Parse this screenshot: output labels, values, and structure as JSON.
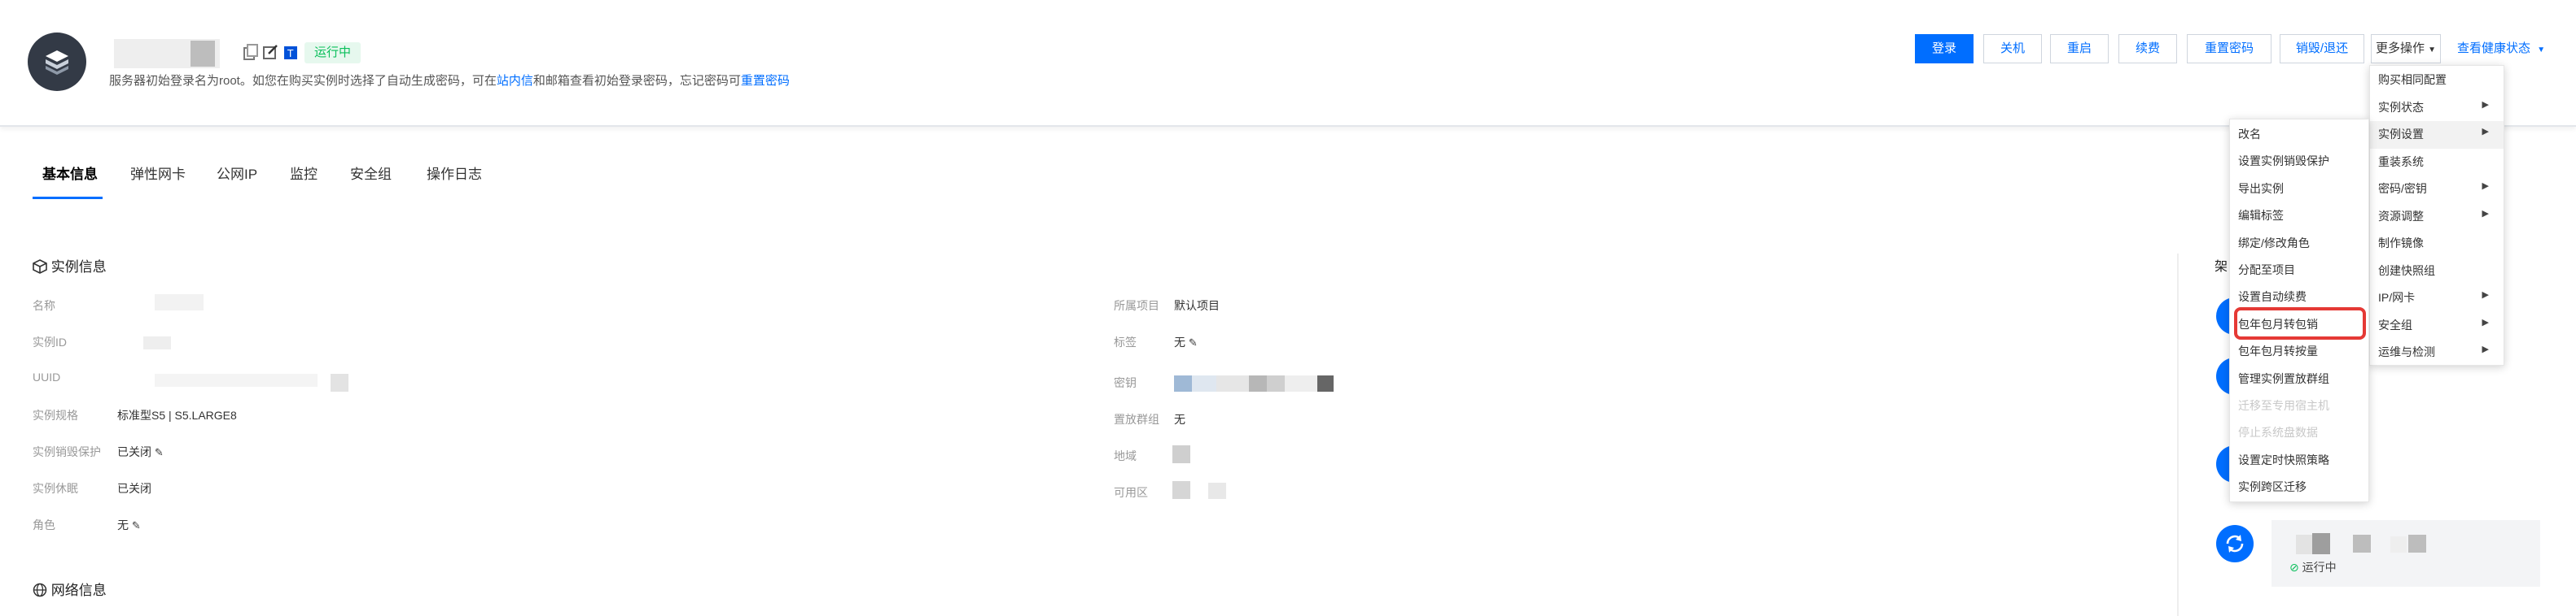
{
  "header": {
    "status": "运行中",
    "notice_prefix": "服务器初始登录名为root。如您在购买实例时选择了自动生成密码，可在",
    "notice_link1": "站内信",
    "notice_middle": "和邮箱查看初始登录密码，忘记密码可",
    "notice_link2": "重置密码",
    "icons": [
      "server-icon",
      "copy-icon",
      "edit-icon",
      "terminal-icon"
    ]
  },
  "actions": {
    "login": "登录",
    "shutdown": "关机",
    "restart": "重启",
    "renew": "续费",
    "reset_password": "重置密码",
    "terminate": "销毁/退还",
    "more": "更多操作",
    "health": "查看健康状态"
  },
  "tabs": [
    "基本信息",
    "弹性网卡",
    "公网IP",
    "监控",
    "安全组",
    "操作日志"
  ],
  "instance_info": {
    "title": "实例信息",
    "left": [
      {
        "label": "名称",
        "value": ""
      },
      {
        "label": "实例ID",
        "value": ""
      },
      {
        "label": "UUID",
        "value": ""
      },
      {
        "label": "实例规格",
        "value": "标准型S5 | S5.LARGE8"
      },
      {
        "label": "实例销毁保护",
        "value": "已关闭"
      },
      {
        "label": "实例休眠",
        "value": "已关闭"
      },
      {
        "label": "角色",
        "value": "无"
      }
    ],
    "right": [
      {
        "label": "所属项目",
        "value": "默认项目"
      },
      {
        "label": "标签",
        "value": "无"
      },
      {
        "label": "密钥",
        "value": ""
      },
      {
        "label": "置放群组",
        "value": "无"
      },
      {
        "label": "地域",
        "value": ""
      },
      {
        "label": "可用区",
        "value": ""
      }
    ]
  },
  "network_info": {
    "title": "网络信息"
  },
  "side": {
    "title_fragment": "架",
    "status": "运行中"
  },
  "more_menu": {
    "items": [
      {
        "label": "购买相同配置",
        "has_sub": false
      },
      {
        "label": "实例状态",
        "has_sub": true
      },
      {
        "label": "实例设置",
        "has_sub": true,
        "highlighted": true
      },
      {
        "label": "重装系统",
        "has_sub": false
      },
      {
        "label": "密码/密钥",
        "has_sub": true
      },
      {
        "label": "资源调整",
        "has_sub": true
      },
      {
        "label": "制作镜像",
        "has_sub": false
      },
      {
        "label": "创建快照组",
        "has_sub": false
      },
      {
        "label": "IP/网卡",
        "has_sub": true
      },
      {
        "label": "安全组",
        "has_sub": true
      },
      {
        "label": "运维与检测",
        "has_sub": true
      }
    ]
  },
  "settings_menu": {
    "items": [
      {
        "label": "改名",
        "disabled": false
      },
      {
        "label": "设置实例销毁保护",
        "disabled": false
      },
      {
        "label": "导出实例",
        "disabled": false
      },
      {
        "label": "编辑标签",
        "disabled": false
      },
      {
        "label": "绑定/修改角色",
        "disabled": false
      },
      {
        "label": "分配至项目",
        "disabled": false
      },
      {
        "label": "设置自动续费",
        "disabled": false
      },
      {
        "label": "包年包月转包销",
        "disabled": false
      },
      {
        "label": "包年包月转按量",
        "disabled": false
      },
      {
        "label": "管理实例置放群组",
        "disabled": false
      },
      {
        "label": "迁移至专用宿主机",
        "disabled": true
      },
      {
        "label": "停止系统盘数据",
        "disabled": true
      },
      {
        "label": "设置定时快照策略",
        "disabled": false
      },
      {
        "label": "实例跨区迁移",
        "disabled": false
      }
    ]
  },
  "colors": {
    "primary": "#006eff",
    "success": "#0abf5b",
    "highlight_box": "#e53935"
  }
}
